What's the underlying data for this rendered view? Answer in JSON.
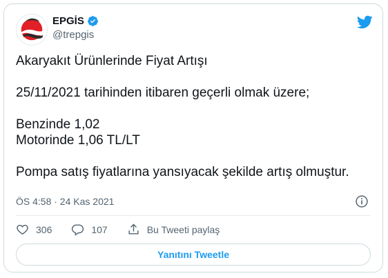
{
  "author": {
    "display_name": "EPGİS",
    "handle": "@trepgis",
    "verified_icon": "verified-badge-icon",
    "avatar_icon": "epgis-logo-icon"
  },
  "tweet": {
    "paragraphs": [
      [
        "Akaryakıt Ürünlerinde Fiyat Artışı"
      ],
      [
        "25/11/2021 tarihinden itibaren geçerli olmak üzere;"
      ],
      [
        "Benzinde 1,02",
        "Motorinde 1,06 TL/LT"
      ],
      [
        "Pompa satış fiyatlarına yansıyacak şekilde artış olmuştur."
      ]
    ],
    "timestamp": "ÖS 4:58 · 24 Kas 2021"
  },
  "actions": {
    "like_count": "306",
    "reply_count": "107",
    "share_label": "Bu Tweeti paylaş"
  },
  "reply_button_label": "Yanıtını Tweetle",
  "colors": {
    "accent": "#1d9bf0",
    "text": "#0f1419",
    "muted": "#536471",
    "border": "#cfd9de",
    "logo_red": "#e01f26"
  }
}
